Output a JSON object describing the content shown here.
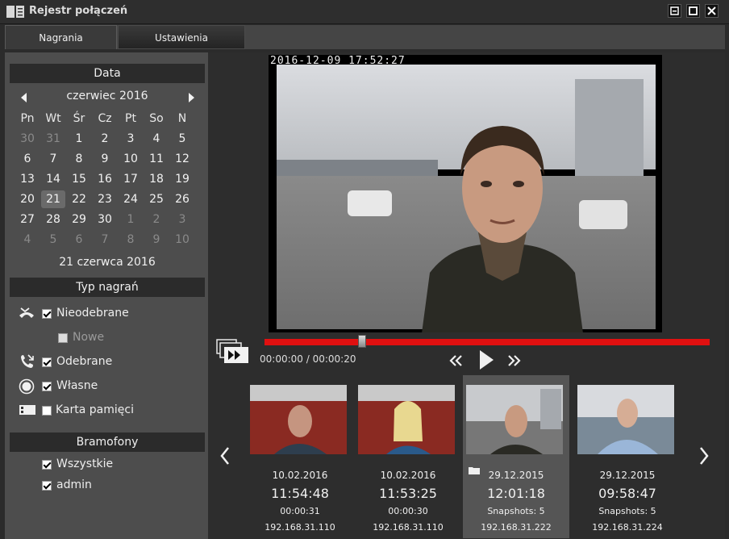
{
  "window": {
    "title": "Rejestr połączeń"
  },
  "tabs": [
    {
      "label": "Nagrania",
      "active": true
    },
    {
      "label": "Ustawienia",
      "active": false
    }
  ],
  "date_section": {
    "header": "Data",
    "month_label": "czerwiec 2016",
    "weekdays": [
      "Pn",
      "Wt",
      "Śr",
      "Cz",
      "Pt",
      "So",
      "N"
    ],
    "weeks": [
      [
        {
          "d": "30",
          "o": true
        },
        {
          "d": "31",
          "o": true
        },
        {
          "d": "1"
        },
        {
          "d": "2"
        },
        {
          "d": "3"
        },
        {
          "d": "4"
        },
        {
          "d": "5"
        }
      ],
      [
        {
          "d": "6"
        },
        {
          "d": "7"
        },
        {
          "d": "8"
        },
        {
          "d": "9"
        },
        {
          "d": "10"
        },
        {
          "d": "11"
        },
        {
          "d": "12"
        }
      ],
      [
        {
          "d": "13"
        },
        {
          "d": "14"
        },
        {
          "d": "15"
        },
        {
          "d": "16"
        },
        {
          "d": "17"
        },
        {
          "d": "18"
        },
        {
          "d": "19"
        }
      ],
      [
        {
          "d": "20"
        },
        {
          "d": "21",
          "s": true
        },
        {
          "d": "22"
        },
        {
          "d": "23"
        },
        {
          "d": "24"
        },
        {
          "d": "25"
        },
        {
          "d": "26"
        }
      ],
      [
        {
          "d": "27"
        },
        {
          "d": "28"
        },
        {
          "d": "29"
        },
        {
          "d": "30"
        },
        {
          "d": "1",
          "o": true
        },
        {
          "d": "2",
          "o": true
        },
        {
          "d": "3",
          "o": true
        }
      ],
      [
        {
          "d": "4",
          "o": true
        },
        {
          "d": "5",
          "o": true
        },
        {
          "d": "6",
          "o": true
        },
        {
          "d": "7",
          "o": true
        },
        {
          "d": "8",
          "o": true
        },
        {
          "d": "9",
          "o": true
        },
        {
          "d": "10",
          "o": true
        }
      ]
    ],
    "selected_date": "21 czerwca 2016"
  },
  "recording_type": {
    "header": "Typ nagrań",
    "filters": [
      {
        "label": "Nieodebrane",
        "checked": true,
        "icon": "missed-call-icon"
      },
      {
        "label": "Nowe",
        "checked": false,
        "disabled": true
      },
      {
        "label": "Odebrane",
        "checked": true,
        "icon": "answered-call-icon"
      },
      {
        "label": "Własne",
        "checked": true,
        "icon": "own-record-icon"
      },
      {
        "label": "Karta pamięci",
        "checked": false,
        "icon": "memory-card-icon"
      }
    ]
  },
  "intercoms": {
    "header": "Bramofony",
    "items": [
      {
        "label": "Wszystkie",
        "checked": true
      },
      {
        "label": "admin",
        "checked": true
      }
    ]
  },
  "player": {
    "osd_timestamp": "2016-12-09 17:52:27",
    "time_readout": "00:00:00 / 00:00:20",
    "progress": 0.22
  },
  "recordings": [
    {
      "date": "10.02.2016",
      "time": "11:54:48",
      "detail": "00:00:31",
      "ip": "192.168.31.110",
      "selected": false,
      "folder": false
    },
    {
      "date": "10.02.2016",
      "time": "11:53:25",
      "detail": "00:00:30",
      "ip": "192.168.31.110",
      "selected": false,
      "folder": false
    },
    {
      "date": "29.12.2015",
      "time": "12:01:18",
      "detail": "Snapshots: 5",
      "ip": "192.168.31.222",
      "selected": true,
      "folder": true
    },
    {
      "date": "29.12.2015",
      "time": "09:58:47",
      "detail": "Snapshots: 5",
      "ip": "192.168.31.224",
      "selected": false,
      "folder": false
    }
  ],
  "colors": {
    "accent_red": "#e01010",
    "panel": "#4d4d4d",
    "dark": "#2d2d2d"
  }
}
